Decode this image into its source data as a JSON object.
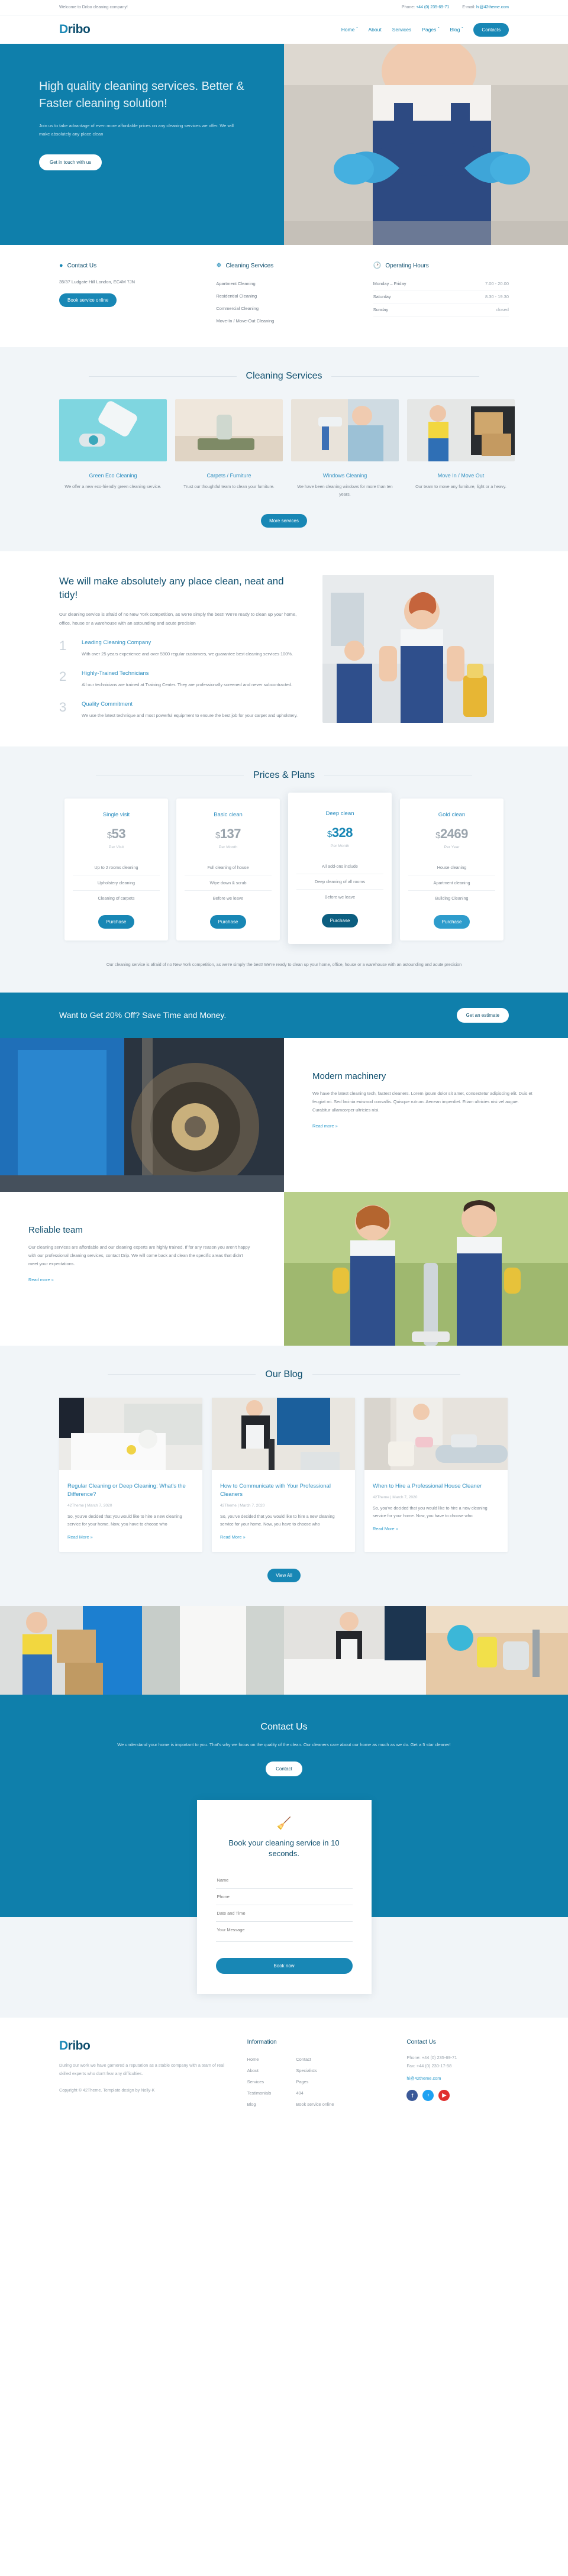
{
  "brand": {
    "name": "Dribo"
  },
  "topbar": {
    "welcome": "Welcome to Dribo cleaning company!",
    "phone_label": "Phone:",
    "phone": "+44 (0) 235-69-71",
    "email_label": "E-mail:",
    "email": "hi@42theme.com"
  },
  "nav": {
    "items": [
      {
        "label": "Home",
        "caret": "ˇ"
      },
      {
        "label": "About",
        "caret": ""
      },
      {
        "label": "Services",
        "caret": ""
      },
      {
        "label": "Pages",
        "caret": "ˇ"
      },
      {
        "label": "Blog",
        "caret": "ˇ"
      }
    ],
    "contacts_button": "Contacts"
  },
  "hero": {
    "title": "High quality cleaning services. Better & Faster cleaning solution!",
    "subtitle": "Join us to take advantage of even more affordable prices on any cleaning services we offer. We will make absolutely any place clean",
    "cta": "Get in touch with us"
  },
  "info": {
    "contact": {
      "icon": "map-pin-icon",
      "title": "Contact Us",
      "address": "35/37 Ludgate Hill London, EC4M 7JN",
      "button": "Book service online"
    },
    "services": {
      "icon": "sparkle-icon",
      "title": "Cleaning Services",
      "items": [
        "Apartment Cleaning",
        "Residential Cleaning",
        "Commercial Cleaning",
        "Move-In / Move-Out Cleaning"
      ]
    },
    "hours": {
      "icon": "clock-icon",
      "title": "Operating Hours",
      "rows": [
        {
          "day": "Monday – Friday",
          "time": "7.00 - 20.00"
        },
        {
          "day": "Saturday",
          "time": "8.30 - 19.30"
        },
        {
          "day": "Sunday",
          "time": "closed"
        }
      ]
    }
  },
  "services_section": {
    "heading": "Cleaning Services",
    "cards": [
      {
        "title": "Green Eco Cleaning",
        "text": "We offer a new eco-friendly green cleaning service.",
        "img": "steam-cleaner-photo"
      },
      {
        "title": "Carpets / Furniture",
        "text": "Trust our thoughtful team to clean your furniture.",
        "img": "vacuum-carpet-photo"
      },
      {
        "title": "Windows Cleaning",
        "text": "We have been cleaning windows for more than ten years.",
        "img": "window-washer-photo"
      },
      {
        "title": "Move In / Move Out",
        "text": "Our team to move any furniture, light or a heavy.",
        "img": "mover-boxes-photo"
      }
    ],
    "button": "More services"
  },
  "about": {
    "title": "We will make absolutely any place clean, neat and tidy!",
    "lead": "Our cleaning service is afraid of no New York competition, as we're simply the best! We're ready to clean up your home, office, house or a warehouse with an astounding and acute precision",
    "points": [
      {
        "num": "1",
        "title": "Leading Cleaning Company",
        "text": "With over 25 years experience and over 5900 regular customers, we guarantee best cleaning services 100%."
      },
      {
        "num": "2",
        "title": "Highly-Trained Technicians",
        "text": "All our technicians are trained at Training Center. They are professionally screened and never subcontracted."
      },
      {
        "num": "3",
        "title": "Quality Commitment",
        "text": "We use the latest technique and most powerful equipment to ensure the best job for your carpet and upholstery."
      }
    ],
    "image": "cleaning-woman-photo"
  },
  "pricing": {
    "heading": "Prices & Plans",
    "plans": [
      {
        "name": "Single visit",
        "currency": "$",
        "price": "53",
        "period": "Per Visit",
        "features": [
          "Up to 2 rooms cleaning",
          "Upholstery cleaning",
          "Cleaning of carpets"
        ],
        "button": "Purchase",
        "featured": false
      },
      {
        "name": "Basic clean",
        "currency": "$",
        "price": "137",
        "period": "Per Month",
        "features": [
          "Full cleaning of house",
          "Wipe down & scrub",
          "Before we leave"
        ],
        "button": "Purchase",
        "featured": false
      },
      {
        "name": "Deep clean",
        "currency": "$",
        "price": "328",
        "period": "Per Month",
        "features": [
          "All add-ons include",
          "Deep cleaning of all rooms",
          "Before we leave"
        ],
        "button": "Purchase",
        "featured": true
      },
      {
        "name": "Gold clean",
        "currency": "$",
        "price": "2469",
        "period": "Per Year",
        "features": [
          "House cleaning",
          "Apartment cleaning",
          "Building Cleaning"
        ],
        "button": "Purchase",
        "featured": false
      }
    ],
    "note": "Our cleaning service is afraid of no New York competition, as we're simply the best! We're ready to clean up your home, office, house or a warehouse with an astounding and acute precision"
  },
  "cta_band": {
    "title": "Want to Get 20% Off? Save Time and Money.",
    "button": "Get an estimate"
  },
  "feature_machinery": {
    "title": "Modern machinery",
    "text": "We have the latest cleaning tech, fastest cleaners. Lorem ipsum dolor sit amet, consectetur adipiscing elit. Duis et feugiat mi. Sed lacinia euismod convallis. Quisque rutrum. Aenean imperdiet. Etiam ultricies nisi vel augue. Curabitur ullamcorper ultricies nisi.",
    "link": "Read more »",
    "image": "street-sweeper-brush-photo"
  },
  "feature_team": {
    "title": "Reliable team",
    "text": "Our cleaning services are affordable and our cleaning experts are highly trained. If for any reason you aren't happy with our professional cleaning services, contact Drip. We will come back and clean the specific areas that didn't meet your expectations.",
    "link": "Read more »",
    "image": "cleaning-team-photo"
  },
  "blog": {
    "heading": "Our Blog",
    "posts": [
      {
        "title": "Regular Cleaning or Deep Cleaning: What's the Difference?",
        "meta": "42Theme | March 7, 2020",
        "excerpt": "So, you've decided that you would like to hire a new cleaning service for your home. Now, you have to choose who",
        "link": "Read More »",
        "img": "folding-towels-photo"
      },
      {
        "title": "How to Communicate with Your Professional Cleaners",
        "meta": "42Theme | March 7, 2020",
        "excerpt": "So, you've decided that you would like to hire a new cleaning service for your home. Now, you have to choose who",
        "link": "Read More »",
        "img": "maid-vacuum-photo"
      },
      {
        "title": "When to Hire a Professional House Cleaner",
        "meta": "42Theme | March 7, 2020",
        "excerpt": "So, you've decided that you would like to hire a new cleaning service for your home. Now, you have to choose who",
        "link": "Read More »",
        "img": "ironing-photo"
      }
    ],
    "button": "View All"
  },
  "contact_section": {
    "heading": "Contact Us",
    "text": "We understand your home is important to you. That's why we focus on the quality of the clean. Our cleaners care about our home as much as we do. Get a 5 star cleaner!",
    "button": "Contact"
  },
  "book_form": {
    "icon": "broom-icon",
    "title": "Book your cleaning service in 10 seconds.",
    "fields": [
      {
        "name": "name-field",
        "placeholder": "Name",
        "value": ""
      },
      {
        "name": "phone-field",
        "placeholder": "Phone",
        "value": ""
      },
      {
        "name": "datetime-field",
        "placeholder": "Date and Time",
        "value": ""
      },
      {
        "name": "message-field",
        "placeholder": "Your Message",
        "value": ""
      }
    ],
    "submit": "Book now"
  },
  "footer": {
    "about": "During our work we have garnered a reputation as a stable company with a team of real skilled experts who don't fear any difficulties.",
    "copyright": "Copyright © 42Theme. Template design by Nelly-K",
    "information_title": "Information",
    "links_col1": [
      "Home",
      "About",
      "Services",
      "Testimonials",
      "Blog"
    ],
    "links_col2": [
      "Contact",
      "Specialists",
      "Pages",
      "404",
      "Book service online"
    ],
    "contact_title": "Contact Us",
    "phone": "Phone: +44 (0) 235-69-71",
    "fax": "Fax: +44 (0) 230-17-58",
    "email": "hi@42theme.com",
    "social": [
      {
        "name": "facebook-icon",
        "glyph": "f"
      },
      {
        "name": "twitter-icon",
        "glyph": "ᵗ"
      },
      {
        "name": "youtube-icon",
        "glyph": "▶"
      }
    ]
  },
  "colors": {
    "primary": "#1887b5",
    "hero": "#0f7fab",
    "dark": "#0f4f6e",
    "grey_bg": "#f1f5f8"
  }
}
